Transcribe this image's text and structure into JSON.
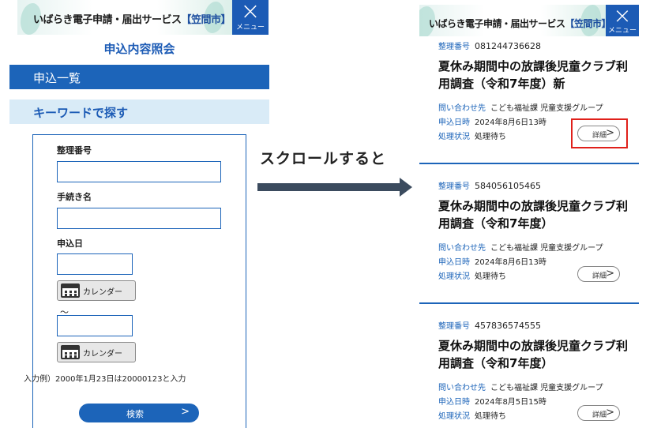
{
  "header": {
    "title": "いばらき電子申請・届出サービス",
    "city": "【笠間市】",
    "menu_icon": "×",
    "menu_label": "メニュー"
  },
  "left": {
    "page_title": "申込内容照会",
    "list_bar": "申込一覧",
    "keyword_bar": "キーワードで探す",
    "form": {
      "field_number": "整理番号",
      "field_procedure": "手続き名",
      "field_date": "申込日",
      "calendar_label": "カレンダー",
      "tilde": "～",
      "hint": "入力例）2000年1月23日は20000123と入力",
      "search_label": "検索",
      "search_arrow": ">"
    }
  },
  "middle": {
    "caption": "スクロールすると"
  },
  "right": {
    "labels": {
      "number": "整理番号",
      "contact": "問い合わせ先",
      "date": "申込日時",
      "status": "処理状況",
      "detail": "詳細",
      "detail_arrow": ">"
    },
    "cards": [
      {
        "number": "081244736628",
        "title": "夏休み期間中の放課後児童クラブ利用調査（令和7年度）新",
        "contact": "こども福祉課 児童支援グループ",
        "date": "2024年8月6日13時",
        "status": "処理待ち"
      },
      {
        "number": "584056105465",
        "title": "夏休み期間中の放課後児童クラブ利用調査（令和7年度）",
        "contact": "こども福祉課 児童支援グループ",
        "date": "2024年8月6日13時",
        "status": "処理待ち"
      },
      {
        "number": "457836574555",
        "title": "夏休み期間中の放課後児童クラブ利用調査（令和7年度）",
        "contact": "こども福祉課 児童支援グループ",
        "date": "2024年8月5日15時",
        "status": "処理待ち"
      }
    ]
  },
  "colors": {
    "primary": "#1c64b9",
    "light_bar": "#d9ebf7",
    "highlight": "#e0201a",
    "arrow": "#3b4b5e"
  }
}
